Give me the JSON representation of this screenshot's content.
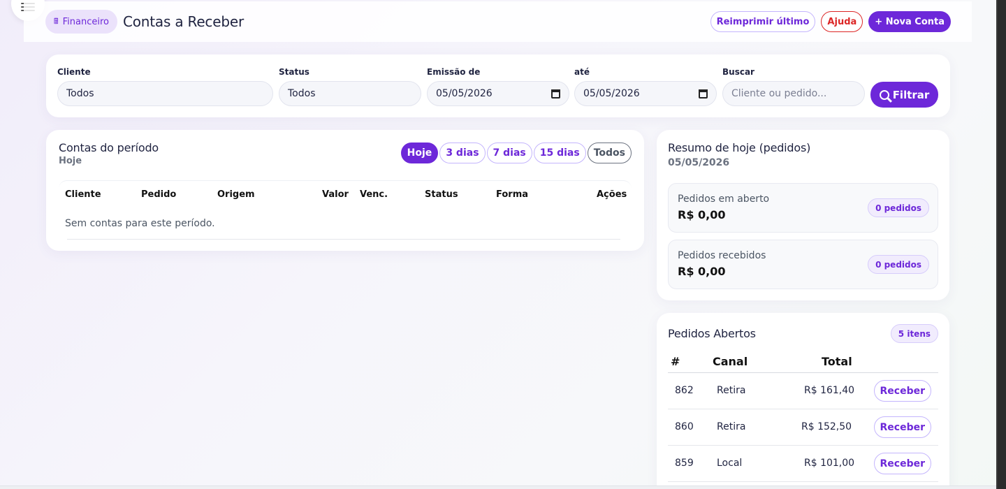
{
  "header": {
    "breadcrumb_icon": "cash-register-icon",
    "breadcrumb_label": "Financeiro",
    "title": "Contas a Receber",
    "reprint_label": "Reimprimir último",
    "help_label": "Ajuda",
    "new_account_label": "+ Nova Conta"
  },
  "filters": {
    "client_label": "Cliente",
    "client_value": "Todos",
    "status_label": "Status",
    "status_value": "Todos",
    "issue_from_label": "Emissão de",
    "issue_from_value": "05/05/2026",
    "issue_to_label": "até",
    "issue_to_value": "05/05/2026",
    "search_label": "Buscar",
    "search_placeholder": "Cliente ou pedido...",
    "filter_button": "Filtrar"
  },
  "accounts": {
    "title": "Contas do período",
    "subtitle": "Hoje",
    "tabs": [
      {
        "label": "Hoje",
        "active": true
      },
      {
        "label": "3 dias",
        "active": false
      },
      {
        "label": "7 dias",
        "active": false
      },
      {
        "label": "15 dias",
        "active": false
      },
      {
        "label": "Todos",
        "active": false
      }
    ],
    "columns": [
      "Cliente",
      "Pedido",
      "Origem",
      "Valor",
      "Venc.",
      "Status",
      "Forma",
      "Ações"
    ],
    "empty_message": "Sem contas para este período."
  },
  "summary": {
    "title": "Resumo de hoje (pedidos)",
    "date": "05/05/2026",
    "items": [
      {
        "label": "Pedidos em aberto",
        "value": "R$ 0,00",
        "count": "0 pedidos"
      },
      {
        "label": "Pedidos recebidos",
        "value": "R$ 0,00",
        "count": "0 pedidos"
      }
    ]
  },
  "open_orders": {
    "title": "Pedidos Abertos",
    "count": "5 itens",
    "columns": [
      "#",
      "Canal",
      "Total"
    ],
    "rows": [
      {
        "id": "862",
        "channel": "Retira",
        "total": "R$ 161,40",
        "action": "Receber"
      },
      {
        "id": "860",
        "channel": "Retira",
        "total": "R$ 152,50",
        "action": "Receber"
      },
      {
        "id": "859",
        "channel": "Local",
        "total": "R$ 101,00",
        "action": "Receber"
      }
    ]
  }
}
